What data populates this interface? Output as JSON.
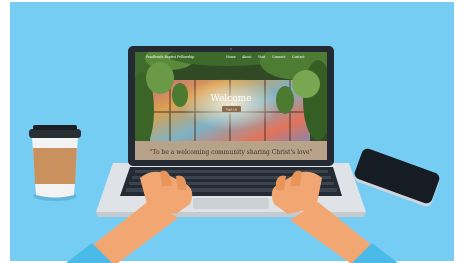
{
  "website": {
    "site_name": "Pendleside Baptist Fellowship",
    "nav_items": [
      "Home",
      "About",
      "Visit",
      "Connect",
      "Contact"
    ],
    "hero_heading": "Welcome",
    "hero_button_label": "Visit Us",
    "tagline": "\"To be a welcoming community sharing Christ's love\""
  },
  "colors": {
    "background": "#76cdf3",
    "laptop_body": "#dfe3e7",
    "bezel": "#232a33",
    "keyboard": "#232a33",
    "skin": "#f2a772",
    "cuff": "#4abbe8",
    "tagline_bar": "#b9a28a",
    "coffee_sleeve": "#c8915d",
    "phone": "#151c24"
  }
}
